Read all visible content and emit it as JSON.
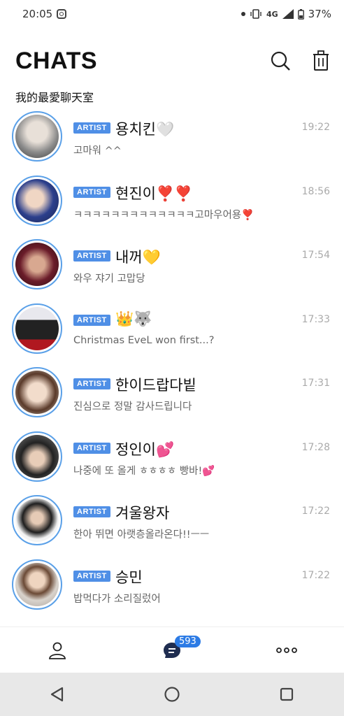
{
  "status_bar": {
    "time": "20:05",
    "network": "4G",
    "battery": "37%"
  },
  "header": {
    "title": "CHATS",
    "subtitle": "我的最愛聊天室"
  },
  "chats": [
    {
      "badge": "ARTIST",
      "name": "용치킨🤍",
      "time": "19:22",
      "message": "고마워 ^^"
    },
    {
      "badge": "ARTIST",
      "name": "현진이❣️❣️",
      "time": "18:56",
      "message": "ㅋㅋㅋㅋㅋㅋㅋㅋㅋㅋㅋㅋㅋ고마우어용❣️"
    },
    {
      "badge": "ARTIST",
      "name": "내꺼💛",
      "time": "17:54",
      "message": "와우 쟈기 고맙당"
    },
    {
      "badge": "ARTIST",
      "name": "👑🐺",
      "time": "17:33",
      "message": "Christmas EveL won first...?"
    },
    {
      "badge": "ARTIST",
      "name": "한이드랍다빝",
      "time": "17:31",
      "message": "진심으로 정말 감사드립니다"
    },
    {
      "badge": "ARTIST",
      "name": "정인이💕",
      "time": "17:28",
      "message": "나중에 또 올게 ㅎㅎㅎㅎ 빵바!💕"
    },
    {
      "badge": "ARTIST",
      "name": "겨울왕자",
      "time": "17:22",
      "message": "한아 뛰면 아랫층올라온다!!ㅡㅡ"
    },
    {
      "badge": "ARTIST",
      "name": "승민",
      "time": "17:22",
      "message": "밥먹다가 소리질렀어"
    }
  ],
  "bottom_nav": {
    "chat_count": "593"
  },
  "icons": [
    "instagram-icon",
    "search-icon",
    "trash-icon",
    "profile-icon",
    "chat-bubble-icon",
    "more-icon",
    "back-icon",
    "home-icon",
    "recents-icon"
  ],
  "colors": {
    "accent": "#4f8fe6",
    "avatar_ring": "#5aa0e8",
    "count_badge": "#2c7be5"
  }
}
